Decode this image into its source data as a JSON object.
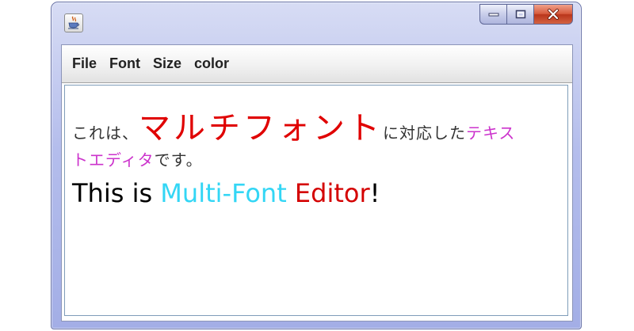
{
  "window": {
    "app_icon": "java-cup-icon",
    "buttons": {
      "minimize": "minimize-icon",
      "maximize": "maximize-icon",
      "close": "close-icon"
    },
    "colors": {
      "frame": "#b4bdec",
      "close_button": "#d65a3c"
    }
  },
  "menubar": {
    "items": [
      "File",
      "Font",
      "Size",
      "color"
    ]
  },
  "editor": {
    "line1": {
      "part1": "これは、",
      "part2": "マルチフォント",
      "part3": "に対応した",
      "part4": "テキス"
    },
    "line2": {
      "part1": "トエディタ",
      "part2": "です。"
    },
    "line3": {
      "part1": "This is ",
      "part2": "Multi-Font",
      "part3": " ",
      "part4": "Editor",
      "part5": "!"
    },
    "colors": {
      "gray": "#333333",
      "red": "#e00000",
      "magenta": "#cc33cc",
      "cyan": "#33d6f5",
      "black": "#000000"
    }
  }
}
